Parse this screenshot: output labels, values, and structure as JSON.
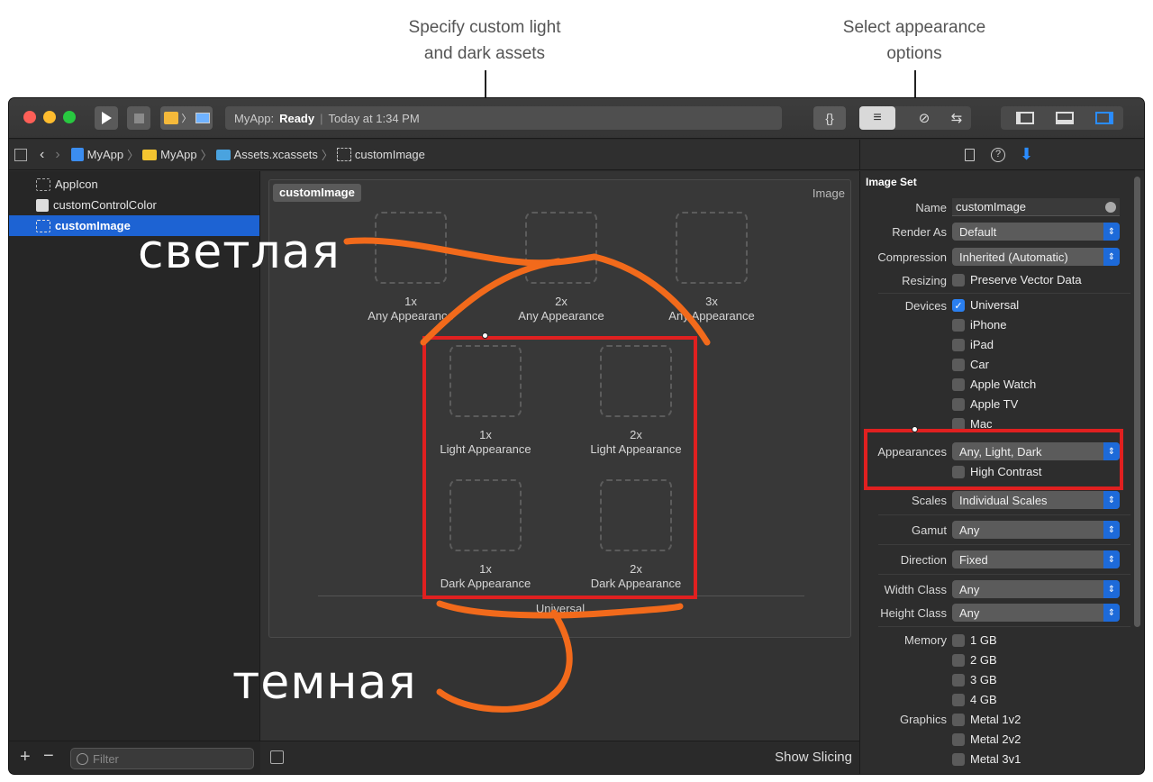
{
  "callouts": {
    "left": "Specify custom light\nand dark assets",
    "right": "Select appearance\noptions"
  },
  "titlebar": {
    "status_app": "MyApp:",
    "status_state": "Ready",
    "status_sep": "|",
    "status_time": "Today at 1:34 PM",
    "braces": "{}"
  },
  "pathbar": {
    "crumbs": [
      "MyApp",
      "MyApp",
      "Assets.xcassets",
      "customImage"
    ]
  },
  "navigator": {
    "items": [
      {
        "label": "AppIcon"
      },
      {
        "label": "customControlColor"
      },
      {
        "label": "customImage"
      }
    ],
    "filter_placeholder": "Filter"
  },
  "editor": {
    "set_name": "customImage",
    "set_type": "Image",
    "slots_row1": [
      {
        "scale": "1x",
        "appearance": "Any Appearance"
      },
      {
        "scale": "2x",
        "appearance": "Any Appearance"
      },
      {
        "scale": "3x",
        "appearance": "Any Appearance"
      }
    ],
    "slots_light": [
      {
        "scale": "1x",
        "appearance": "Light Appearance"
      },
      {
        "scale": "2x",
        "appearance": "Light Appearance"
      }
    ],
    "slots_dark": [
      {
        "scale": "1x",
        "appearance": "Dark Appearance"
      },
      {
        "scale": "2x",
        "appearance": "Dark Appearance"
      }
    ],
    "universal": "Universal",
    "show_slicing": "Show Slicing"
  },
  "inspector": {
    "section_title": "Image Set",
    "name_label": "Name",
    "name_value": "customImage",
    "render_label": "Render As",
    "render_value": "Default",
    "compression_label": "Compression",
    "compression_value": "Inherited (Automatic)",
    "resizing_label": "Resizing",
    "resizing_value": "Preserve Vector Data",
    "devices_label": "Devices",
    "devices": [
      "Universal",
      "iPhone",
      "iPad",
      "Car",
      "Apple Watch",
      "Apple TV",
      "Mac"
    ],
    "appearances_label": "Appearances",
    "appearances_value": "Any, Light, Dark",
    "high_contrast": "High Contrast",
    "scales_label": "Scales",
    "scales_value": "Individual Scales",
    "gamut_label": "Gamut",
    "gamut_value": "Any",
    "direction_label": "Direction",
    "direction_value": "Fixed",
    "width_label": "Width Class",
    "width_value": "Any",
    "height_label": "Height Class",
    "height_value": "Any",
    "memory_label": "Memory",
    "memory": [
      "1 GB",
      "2 GB",
      "3 GB",
      "4 GB"
    ],
    "graphics_label": "Graphics",
    "graphics": [
      "Metal 1v2",
      "Metal 2v2",
      "Metal 3v1"
    ]
  },
  "annotations": {
    "light": "светлая",
    "dark": "темная"
  },
  "colors": {
    "accent": "#1d63d3",
    "annotation_stroke": "#f26a1b",
    "highlight_box": "#e02020"
  }
}
